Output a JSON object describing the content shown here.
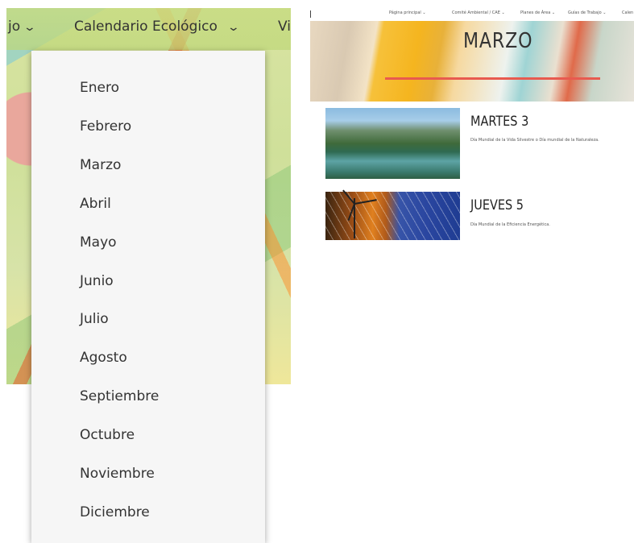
{
  "left_nav": {
    "items": [
      {
        "label": "jo"
      },
      {
        "label": "Calendario Ecológico"
      },
      {
        "label": "Vi"
      }
    ]
  },
  "dropdown": {
    "months": [
      "Enero",
      "Febrero",
      "Marzo",
      "Abril",
      "Mayo",
      "Junio",
      "Julio",
      "Agosto",
      "Septiembre",
      "Octubre",
      "Noviembre",
      "Diciembre"
    ]
  },
  "right_nav": {
    "items": [
      {
        "label": "Página principal"
      },
      {
        "label": "Comité Ambiental / CAE"
      },
      {
        "label": "Planes de Área"
      },
      {
        "label": "Guías de Trabajo"
      },
      {
        "label": "Calen"
      }
    ]
  },
  "hero": {
    "title": "MARZO"
  },
  "events": [
    {
      "title": "MARTES 3",
      "description": "Día Mundial de la Vida Silvestre o Día mundial de la Naturaleza."
    },
    {
      "title": "JUEVES 5",
      "description": "Día Mundial de la Eficiencia Energética."
    }
  ],
  "colors": {
    "accent_bar": "#e85a4f",
    "dropdown_bg": "#f6f6f6",
    "text": "#333333"
  }
}
